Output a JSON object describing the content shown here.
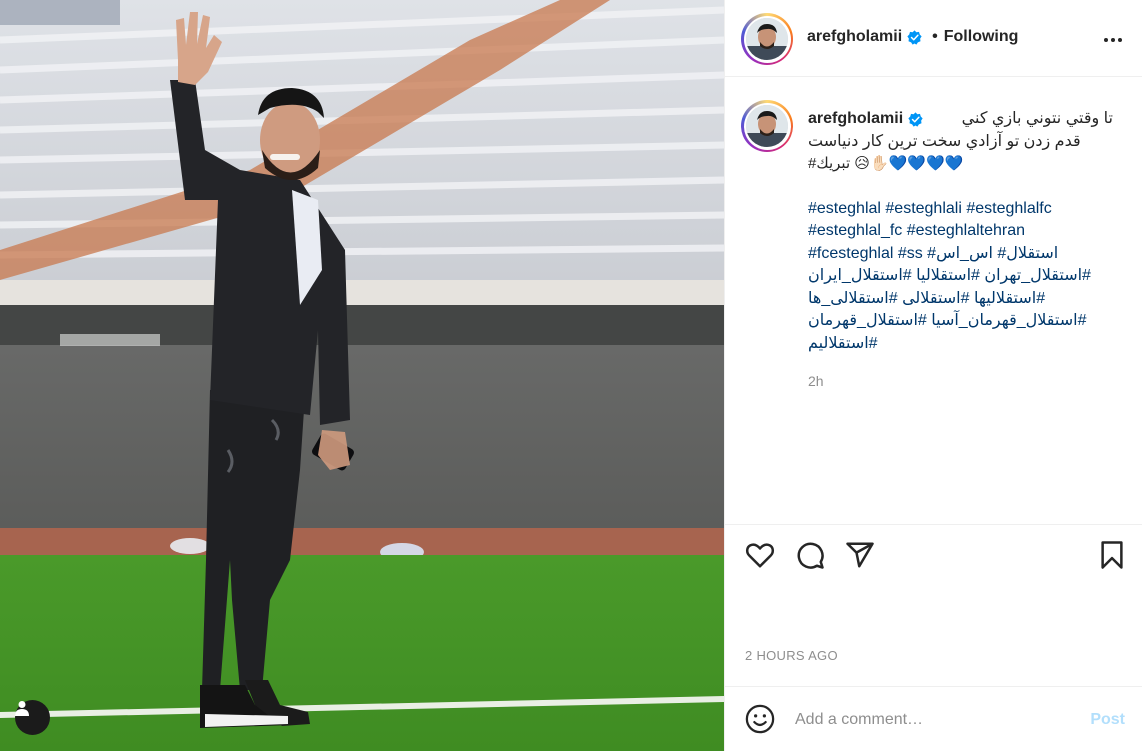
{
  "post": {
    "username": "arefgholamii",
    "verified_icon": "verified-badge-icon",
    "dot": "•",
    "follow_status": "Following",
    "more_icon": "more-options-icon",
    "caption_lines": [
      "تا وقتي نتوني بازي كني",
      "قدم زدن تو آزادي سخت ترين كار دنياست",
      "💙💙💙💙✋🏻😥 تبريك#"
    ],
    "hashtag_lines": [
      "#esteghlal #esteghlali #esteghlalfc",
      "#esteghlal_fc #esteghlaltehran",
      "#fcesteghlal #ss #استقلال# اس_اس",
      "#استقلال_تهران #استقلاليا #استقلال_ايران",
      "#استقلاليها #استقلالی #استقلالی_ها",
      "#استقلال_قهرمان_آسيا #استقلال_قهرمان",
      "#استقلاليم"
    ],
    "time_ago": "2h",
    "posted_time": "2 HOURS AGO"
  },
  "actions": {
    "like_icon": "heart-icon",
    "comment_icon": "comment-icon",
    "share_icon": "share-icon",
    "save_icon": "bookmark-icon"
  },
  "comment": {
    "placeholder": "Add a comment…",
    "post_label": "Post",
    "emoji_icon": "emoji-icon"
  },
  "photo": {
    "tag_icon": "user-tag-icon"
  },
  "colors": {
    "link": "#00376b",
    "secondary": "#8e8e8e",
    "post_disabled": "#b2dffc",
    "verified": "#0095f6"
  }
}
